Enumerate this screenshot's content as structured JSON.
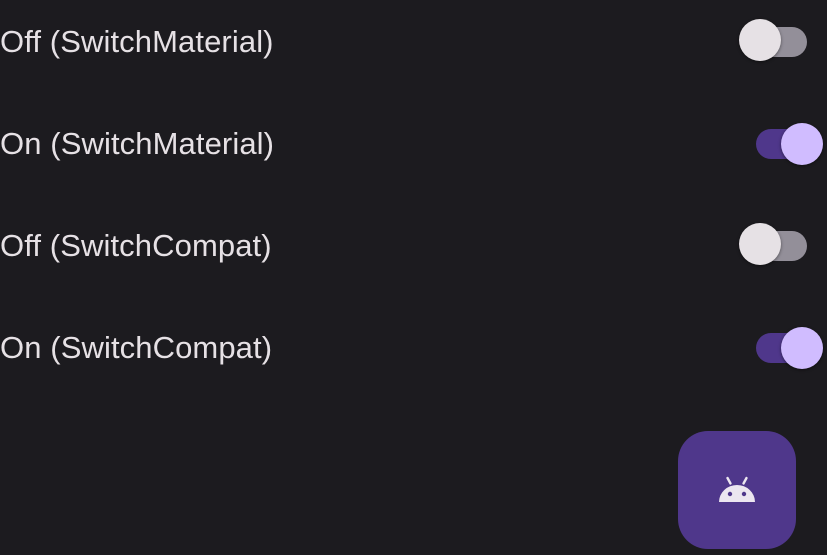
{
  "switches": [
    {
      "label": "Off (SwitchMaterial)",
      "checked": false
    },
    {
      "label": "On (SwitchMaterial)",
      "checked": true
    },
    {
      "label": "Off (SwitchCompat)",
      "checked": false
    },
    {
      "label": "On (SwitchCompat)",
      "checked": true
    }
  ],
  "fab": {
    "icon": "android-icon"
  },
  "colors": {
    "background": "#1c1b1f",
    "text": "#e6e1e5",
    "on_track": "#4f378b",
    "on_thumb": "#d0bcff",
    "off_track": "#938f99",
    "off_thumb": "#e6e1e5",
    "fab": "#4f378b"
  }
}
